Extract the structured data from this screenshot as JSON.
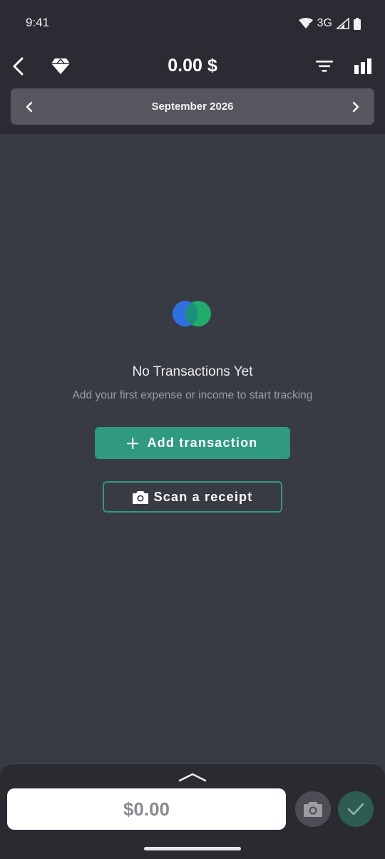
{
  "status_bar": {
    "time": "9:41",
    "network": "3G",
    "icons": [
      "wifi-icon",
      "signal-icon",
      "battery-icon"
    ]
  },
  "app_bar": {
    "balance": "0.00 $",
    "icons": [
      "back-arrow-icon",
      "diamond-icon",
      "filter-icon",
      "bar-chart-icon"
    ]
  },
  "month_selector": {
    "label": "September 2026",
    "icons": [
      "chevron-left-icon",
      "chevron-right-icon"
    ]
  },
  "empty_state": {
    "title": "No Transactions Yet",
    "subtitle": "Add your first expense or income to start tracking",
    "add_button_label": "Add transaction",
    "scan_button_label": "Scan a receipt",
    "icons": [
      "app-logo-icon",
      "plus-icon",
      "camera-icon"
    ]
  },
  "bottom_sheet": {
    "amount_placeholder": "$0.00",
    "icons": [
      "chevron-up-icon",
      "camera-icon",
      "check-icon"
    ]
  },
  "colors": {
    "background": "#393b44",
    "header": "#2b2c33",
    "accent": "#2f9a80",
    "confirm": "#2e5c51",
    "logo_blue": "#2f6fe0",
    "logo_green": "#1fb871"
  }
}
